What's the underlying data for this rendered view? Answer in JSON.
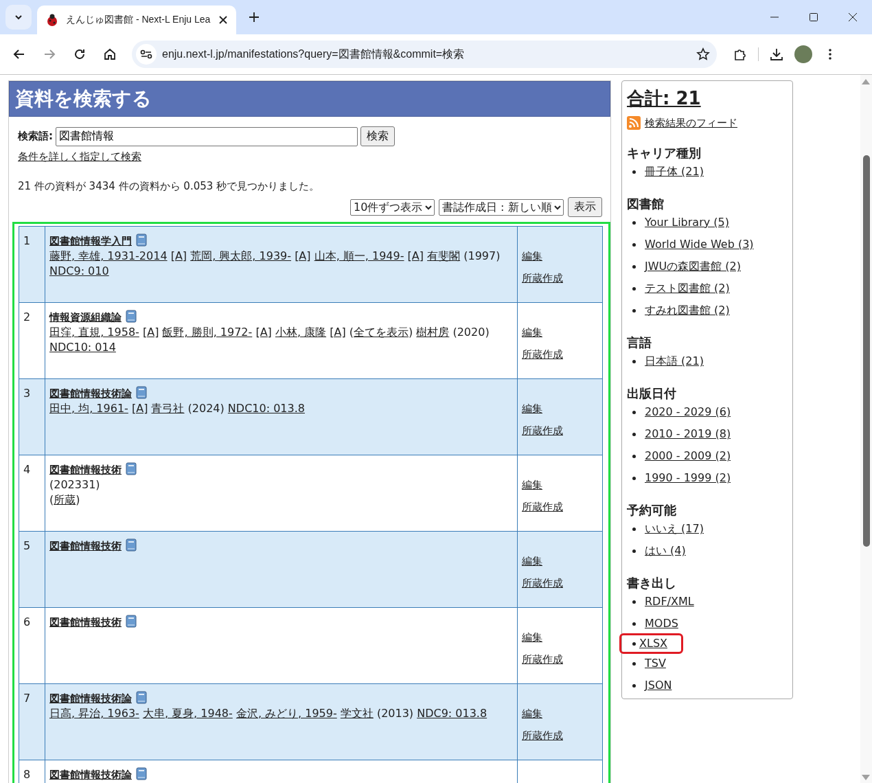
{
  "browser": {
    "tab_title": "えんじゅ図書館 - Next-L Enju Lea",
    "url": "enju.next-l.jp/manifestations?query=図書館情報&commit=検索"
  },
  "search": {
    "heading": "資料を検索する",
    "label": "検索語:",
    "value": "図書館情報",
    "button": "検索",
    "advanced_link": "条件を詳しく指定して検索",
    "summary": "21 件の資料が 3434 件の資料から 0.053 秒で見つかりました。",
    "per_page": "10件ずつ表示",
    "sort": "書誌作成日 : 新しい順",
    "apply_button": "表示"
  },
  "results": {
    "highlighted": true,
    "rows": [
      {
        "number": "1",
        "title": "図書館情報学入門",
        "lines": [
          [
            {
              "kind": "author",
              "text": "藤野, 幸雄, 1931-2014"
            },
            {
              "kind": "role",
              "text": "[A]"
            },
            {
              "kind": "author",
              "text": "荒岡, 興太郎, 1939-"
            },
            {
              "kind": "role",
              "text": "[A]"
            },
            {
              "kind": "author",
              "text": "山本, 順一, 1949-"
            },
            {
              "kind": "role",
              "text": "[A]"
            },
            {
              "kind": "publisher",
              "text": "有斐閣"
            },
            {
              "kind": "year",
              "text": "(1997)"
            },
            {
              "kind": "classification",
              "text": "NDC9: 010"
            }
          ]
        ],
        "actions": [
          "編集",
          "所蔵作成"
        ]
      },
      {
        "number": "2",
        "title": "情報資源組織論",
        "lines": [
          [
            {
              "kind": "author",
              "text": "田窪, 直規, 1958-"
            },
            {
              "kind": "role",
              "text": "[A]"
            },
            {
              "kind": "author",
              "text": "飯野, 勝則, 1972-"
            },
            {
              "kind": "role",
              "text": "[A]"
            },
            {
              "kind": "author",
              "text": "小林, 康隆"
            },
            {
              "kind": "role",
              "text": "[A]"
            },
            {
              "kind": "more",
              "open": "(",
              "text": "全てを表示",
              "close": ")"
            },
            {
              "kind": "publisher",
              "text": "樹村房"
            },
            {
              "kind": "year",
              "text": "(2020)"
            },
            {
              "kind": "classification",
              "text": "NDC10: 014"
            }
          ]
        ],
        "actions": [
          "編集",
          "所蔵作成"
        ]
      },
      {
        "number": "3",
        "title": "図書館情報技術論",
        "lines": [
          [
            {
              "kind": "author",
              "text": "田中, 均, 1961-"
            },
            {
              "kind": "role",
              "text": "[A]"
            },
            {
              "kind": "publisher",
              "text": "青弓社"
            },
            {
              "kind": "year",
              "text": "(2024)"
            },
            {
              "kind": "classification",
              "text": "NDC10: 013.8"
            }
          ]
        ],
        "actions": [
          "編集",
          "所蔵作成"
        ]
      },
      {
        "number": "4",
        "title": "図書館情報技術",
        "lines": [
          [
            {
              "kind": "year",
              "text": "(202331)"
            }
          ],
          [
            {
              "kind": "holding",
              "open": "(",
              "text": "所蔵",
              "close": ")"
            }
          ]
        ],
        "actions": [
          "編集",
          "所蔵作成"
        ]
      },
      {
        "number": "5",
        "title": "図書館情報技術",
        "lines": [],
        "actions": [
          "編集",
          "所蔵作成"
        ]
      },
      {
        "number": "6",
        "title": "図書館情報技術",
        "lines": [],
        "actions": [
          "編集",
          "所蔵作成"
        ]
      },
      {
        "number": "7",
        "title": "図書館情報技術論",
        "lines": [
          [
            {
              "kind": "author",
              "text": "日高, 昇治, 1963-"
            },
            {
              "kind": "author",
              "text": "大串, 夏身, 1948-"
            },
            {
              "kind": "author",
              "text": "金沢, みどり, 1959-"
            },
            {
              "kind": "publisher",
              "text": "学文社"
            },
            {
              "kind": "year",
              "text": "(2013)"
            },
            {
              "kind": "classification",
              "text": "NDC9: 013.8"
            }
          ]
        ],
        "actions": [
          "編集",
          "所蔵作成"
        ]
      },
      {
        "number": "8",
        "title": "図書館情報技術論",
        "lines": [],
        "actions": []
      }
    ]
  },
  "sidebar": {
    "total": "合計: 21",
    "feed_link": "検索結果のフィード",
    "facets": [
      {
        "heading": "キャリア種別",
        "items": [
          {
            "text": "冊子体 (21)",
            "highlighted": false
          }
        ]
      },
      {
        "heading": "図書館",
        "items": [
          {
            "text": "Your Library (5)",
            "highlighted": false
          },
          {
            "text": "World Wide Web (3)",
            "highlighted": false
          },
          {
            "text": "JWUの森図書館 (2)",
            "highlighted": false
          },
          {
            "text": "テスト図書館 (2)",
            "highlighted": false
          },
          {
            "text": "すみれ図書館 (2)",
            "highlighted": false
          }
        ]
      },
      {
        "heading": "言語",
        "items": [
          {
            "text": "日本語 (21)",
            "highlighted": false
          }
        ]
      },
      {
        "heading": "出版日付",
        "items": [
          {
            "text": "2020 - 2029 (6)",
            "highlighted": false
          },
          {
            "text": "2010 - 2019 (8)",
            "highlighted": false
          },
          {
            "text": "2000 - 2009 (2)",
            "highlighted": false
          },
          {
            "text": "1990 - 1999 (2)",
            "highlighted": false
          }
        ]
      },
      {
        "heading": "予約可能",
        "items": [
          {
            "text": "いいえ (17)",
            "highlighted": false
          },
          {
            "text": "はい (4)",
            "highlighted": false
          }
        ]
      },
      {
        "heading": "書き出し",
        "items": [
          {
            "text": "RDF/XML",
            "highlighted": false
          },
          {
            "text": "MODS",
            "highlighted": false
          },
          {
            "text": "XLSX",
            "highlighted": true
          },
          {
            "text": "TSV",
            "highlighted": false
          },
          {
            "text": "JSON",
            "highlighted": false
          }
        ]
      }
    ]
  }
}
